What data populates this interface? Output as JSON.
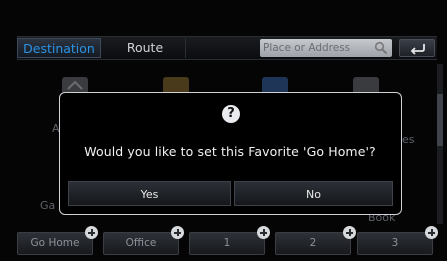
{
  "tabs": {
    "destination": "Destination",
    "route": "Route"
  },
  "search": {
    "placeholder": "Place or Address",
    "icon": "magnifier-icon"
  },
  "back_icon": "back-arrow-icon",
  "background_fragments": {
    "left_a": "A",
    "right_es": "es",
    "left_ga": "Ga",
    "right_book": "Book"
  },
  "favorites": [
    {
      "label": "Go Home"
    },
    {
      "label": "Office"
    },
    {
      "label": "1"
    },
    {
      "label": "2"
    },
    {
      "label": "3"
    }
  ],
  "dialog": {
    "icon": "question-icon",
    "icon_glyph": "?",
    "message": "Would you like to set this Favorite 'Go Home'?",
    "yes_label": "Yes",
    "no_label": "No"
  },
  "colors": {
    "active_tab": "#2b93e6"
  }
}
